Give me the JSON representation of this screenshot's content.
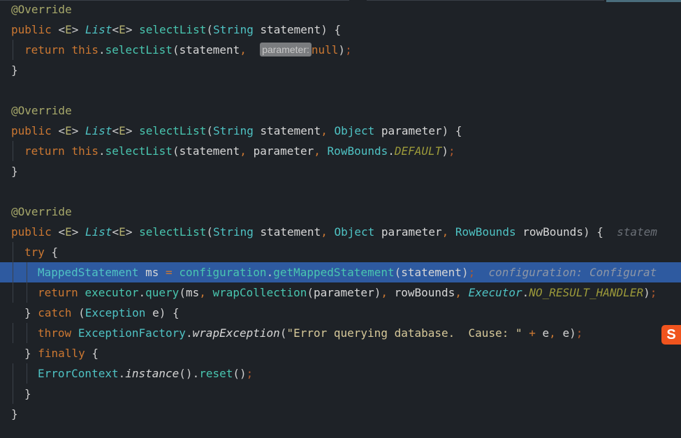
{
  "editor": {
    "theme_background": "#1e2227",
    "highlight_color": "#2e5aa0",
    "lines": [
      {
        "text": "@Override"
      },
      {
        "text": "public <E> List<E> selectList(String statement) {"
      },
      {
        "text": "return this.selectList(statement, null);",
        "inlay_hint": "parameter:"
      },
      {
        "text": "}"
      },
      {
        "text": ""
      },
      {
        "text": "@Override"
      },
      {
        "text": "public <E> List<E> selectList(String statement, Object parameter) {"
      },
      {
        "text": "return this.selectList(statement, parameter, RowBounds.DEFAULT);"
      },
      {
        "text": "}"
      },
      {
        "text": ""
      },
      {
        "text": "@Override"
      },
      {
        "text": "public <E> List<E> selectList(String statement, Object parameter, RowBounds rowBounds) {",
        "trailing_hint": "statem"
      },
      {
        "text": "try {"
      },
      {
        "text": "MappedStatement ms = configuration.getMappedStatement(statement);",
        "trailing_hint": "configuration: Configurat",
        "highlighted": true
      },
      {
        "text": "return executor.query(ms, wrapCollection(parameter), rowBounds, Executor.NO_RESULT_HANDLER);"
      },
      {
        "text": "} catch (Exception e) {"
      },
      {
        "text": "throw ExceptionFactory.wrapException(\"Error querying database.  Cause: \" + e, e);"
      },
      {
        "text": "} finally {"
      },
      {
        "text": "ErrorContext.instance().reset();"
      },
      {
        "text": "}"
      },
      {
        "text": "}"
      }
    ]
  },
  "ime_badge": {
    "label": "S",
    "color": "#f0541e"
  }
}
